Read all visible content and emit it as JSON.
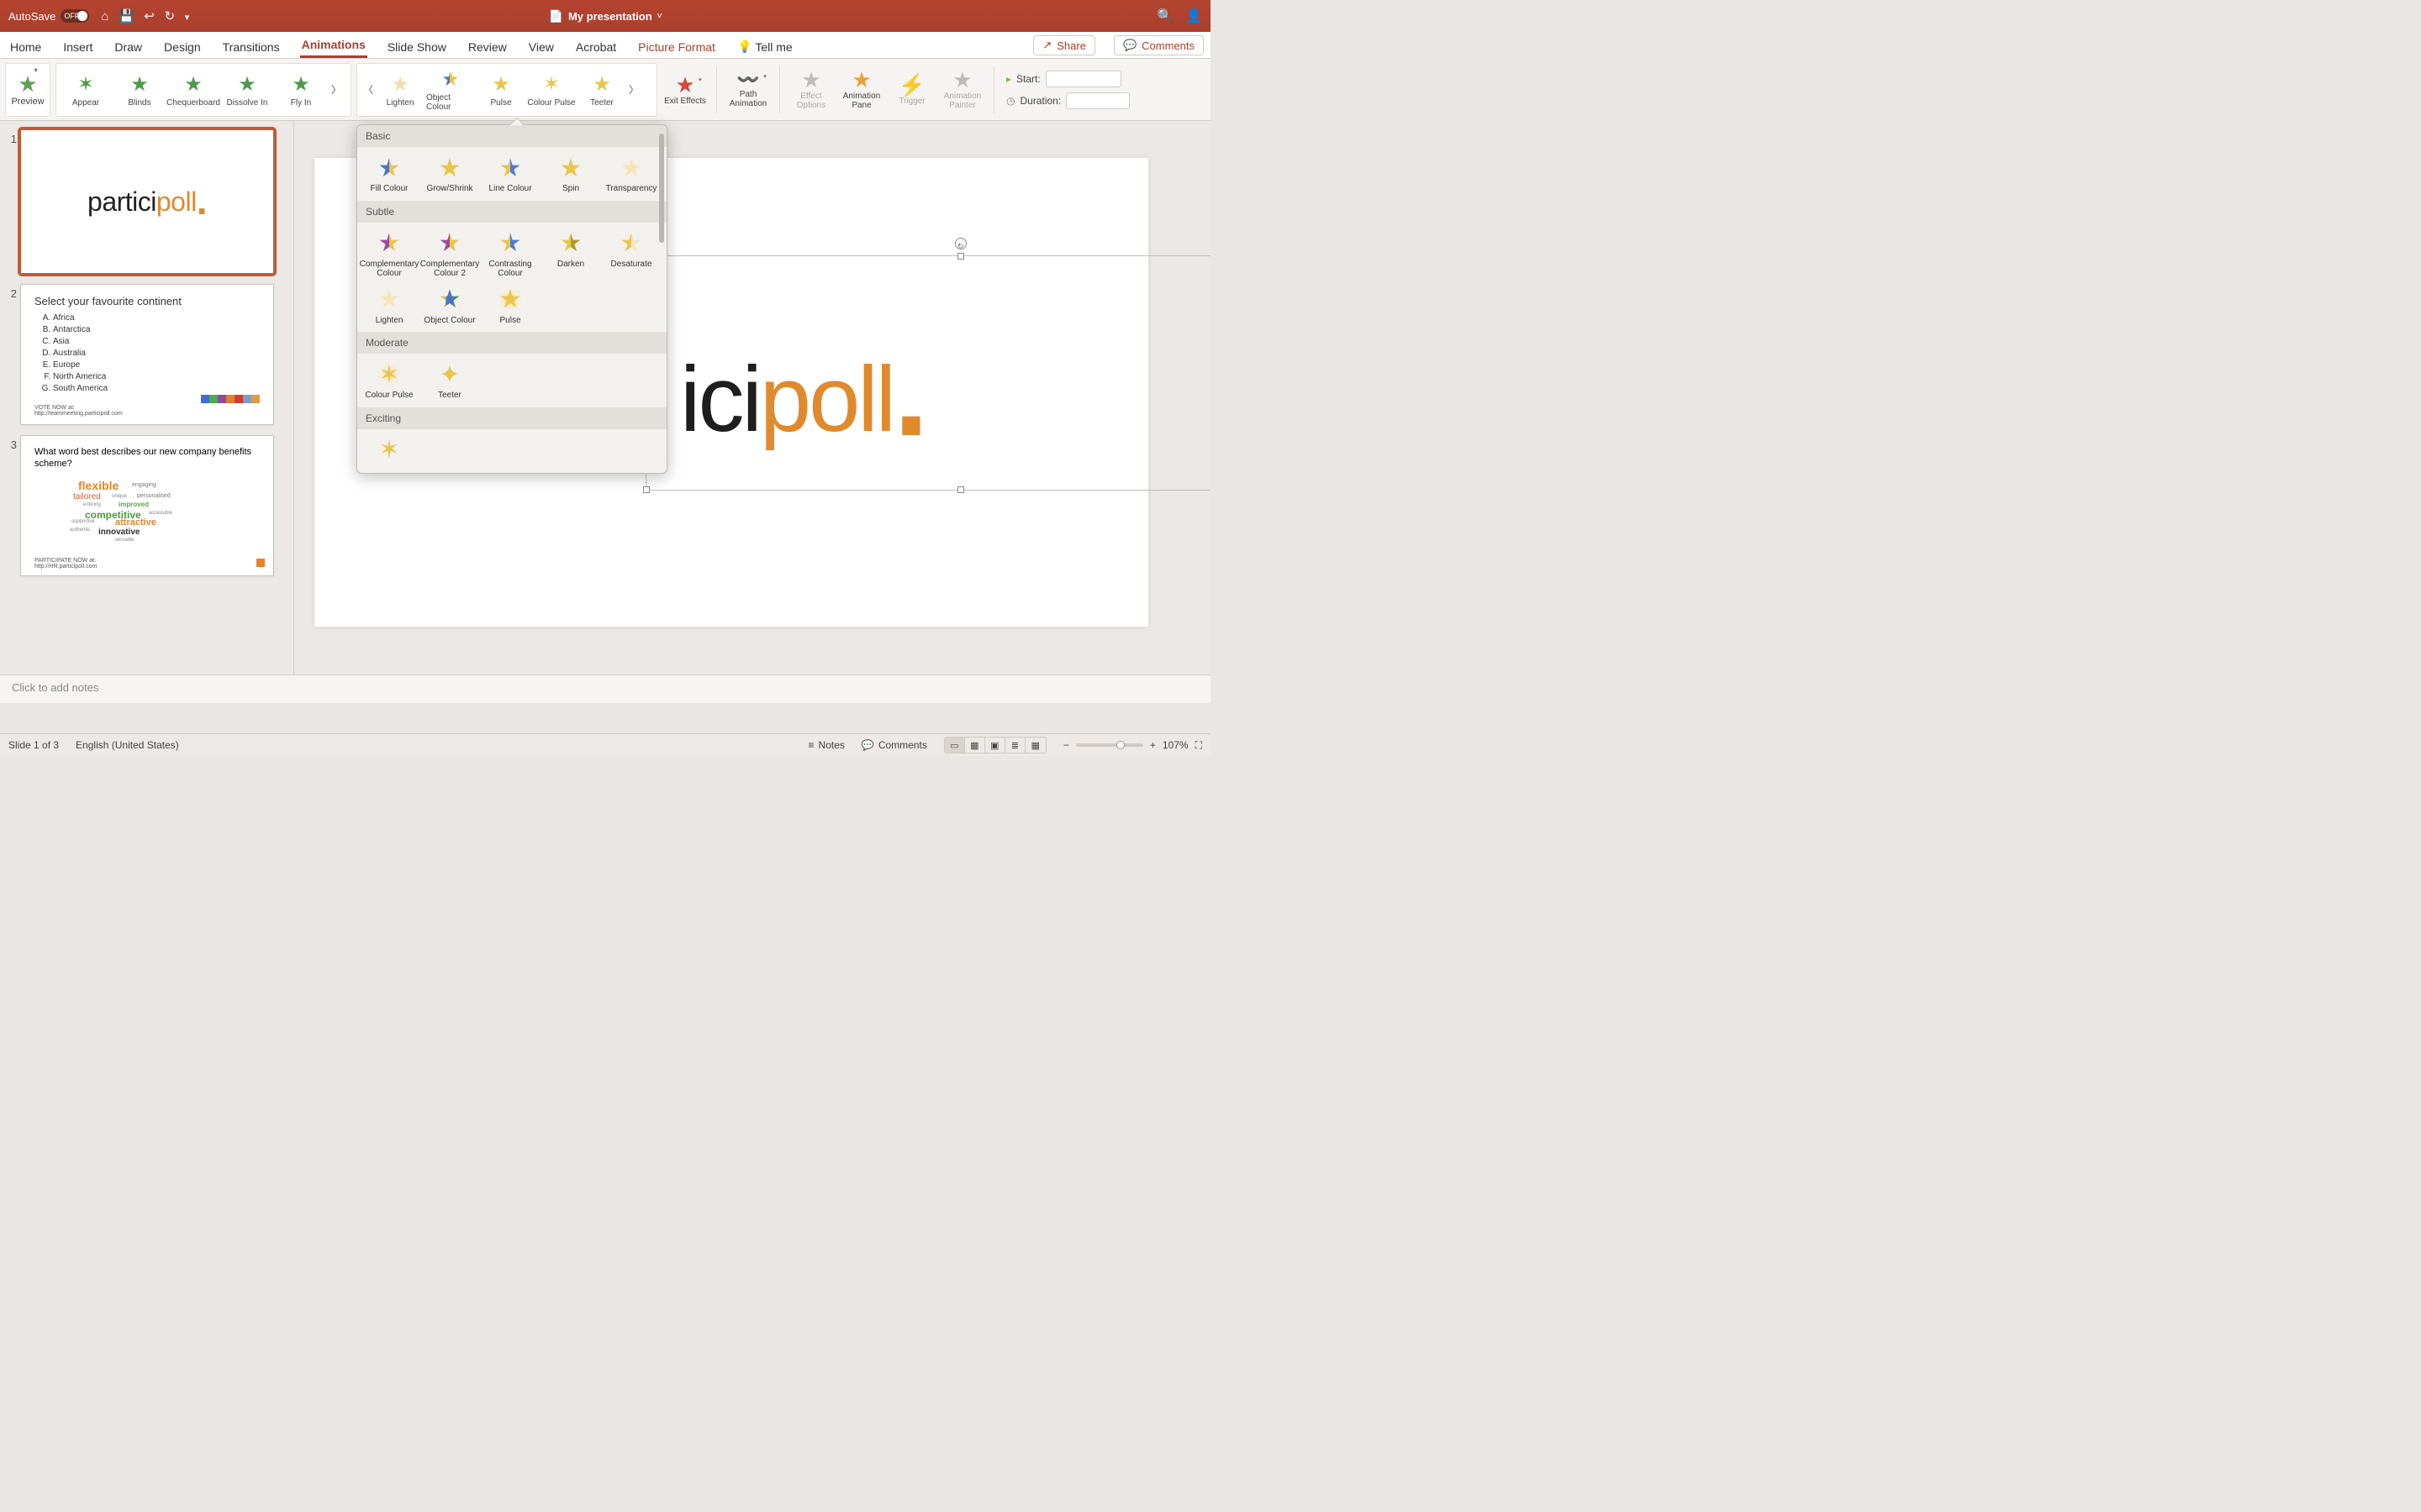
{
  "titlebar": {
    "autosave_label": "AutoSave",
    "autosave_state": "OFF",
    "doc_title": "My presentation"
  },
  "tabs": {
    "home": "Home",
    "insert": "Insert",
    "draw": "Draw",
    "design": "Design",
    "transitions": "Transitions",
    "animations": "Animations",
    "slideshow": "Slide Show",
    "review": "Review",
    "view": "View",
    "acrobat": "Acrobat",
    "picture_format": "Picture Format",
    "tellme": "Tell me",
    "share": "Share",
    "comments": "Comments"
  },
  "ribbon": {
    "preview": "Preview",
    "entrance": [
      "Appear",
      "Blinds",
      "Chequerboard",
      "Dissolve In",
      "Fly In"
    ],
    "emphasis": [
      "Lighten",
      "Object Colour",
      "Pulse",
      "Colour Pulse",
      "Teeter"
    ],
    "exit": "Exit Effects",
    "path": "Path Animation",
    "options": "Effect Options",
    "pane": "Animation Pane",
    "trigger": "Trigger",
    "painter": "Animation Painter",
    "start_label": "Start:",
    "duration_label": "Duration:"
  },
  "dropdown": {
    "basic": "Basic",
    "basic_items": [
      "Fill Colour",
      "Grow/Shrink",
      "Line Colour",
      "Spin",
      "Transparency"
    ],
    "subtle": "Subtle",
    "subtle_items": [
      "Complementary Colour",
      "Complementary Colour 2",
      "Contrasting Colour",
      "Darken",
      "Desaturate",
      "Lighten",
      "Object Colour",
      "Pulse"
    ],
    "moderate": "Moderate",
    "moderate_items": [
      "Colour Pulse",
      "Teeter"
    ],
    "exciting": "Exciting"
  },
  "slides": {
    "s2_title": "Select your favourite continent",
    "s2_items": [
      "Africa",
      "Antarctica",
      "Asia",
      "Australia",
      "Europe",
      "North America",
      "South America"
    ],
    "s2_vote": "VOTE NOW at:",
    "s2_url": "http://teammeeting.participoll.com",
    "s3_title": "What word best describes our new company benefits scheme?",
    "s3_partnow": "PARTICIPATE NOW at:",
    "s3_url": "http://HR.participoll.com",
    "cloud": {
      "flexible": "flexible",
      "engaging": "engaging",
      "tailored": "tailored",
      "unique": "unique",
      "personalised": "personalised",
      "enticing": "enticing",
      "improved": "improved",
      "competitive": "competitive",
      "accessible": "accessible",
      "supportive": "supportive",
      "attractive": "attractive",
      "authentic": "authentic",
      "innovative": "innovative",
      "versatile": "versatile"
    }
  },
  "notes_placeholder": "Click to add notes",
  "status": {
    "slide": "Slide 1 of 3",
    "lang": "English (United States)",
    "notes": "Notes",
    "comments": "Comments",
    "zoom": "107%"
  }
}
